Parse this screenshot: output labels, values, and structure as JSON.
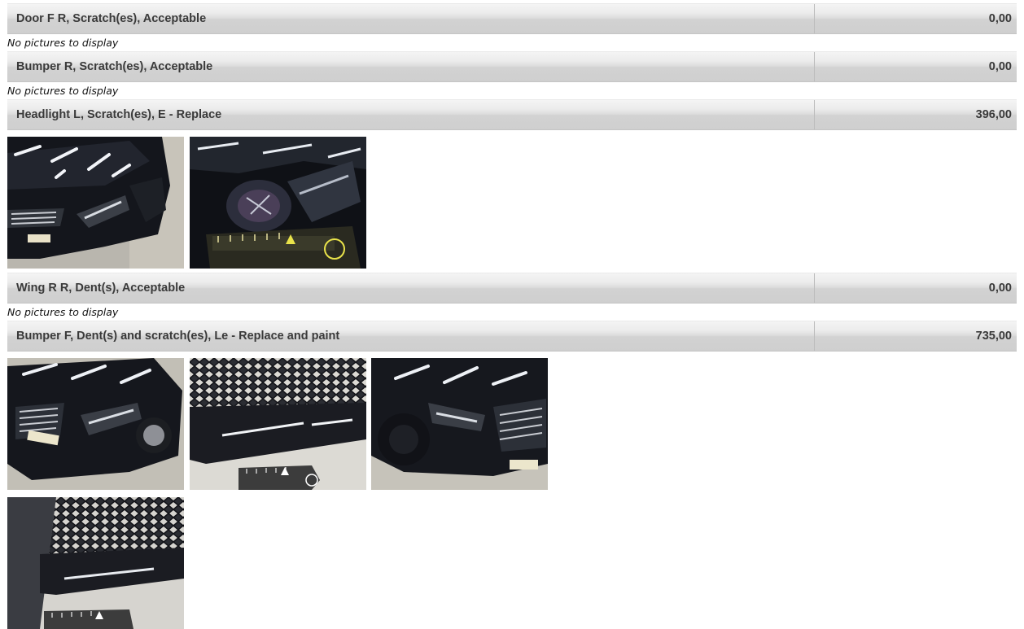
{
  "damage_items": [
    {
      "description": "Door F R, Scratch(es), Acceptable",
      "amount": "0,00",
      "no_pictures_text": "No pictures to display"
    },
    {
      "description": "Bumper R, Scratch(es), Acceptable",
      "amount": "0,00",
      "no_pictures_text": "No pictures to display"
    },
    {
      "description": "Headlight L, Scratch(es), E - Replace",
      "amount": "396,00",
      "photo_count": 2
    },
    {
      "description": "Wing R R, Dent(s), Acceptable",
      "amount": "0,00",
      "no_pictures_text": "No pictures to display"
    },
    {
      "description": "Bumper F, Dent(s) and scratch(es), Le - Replace and paint",
      "amount": "735,00",
      "photo_count": 4
    }
  ]
}
